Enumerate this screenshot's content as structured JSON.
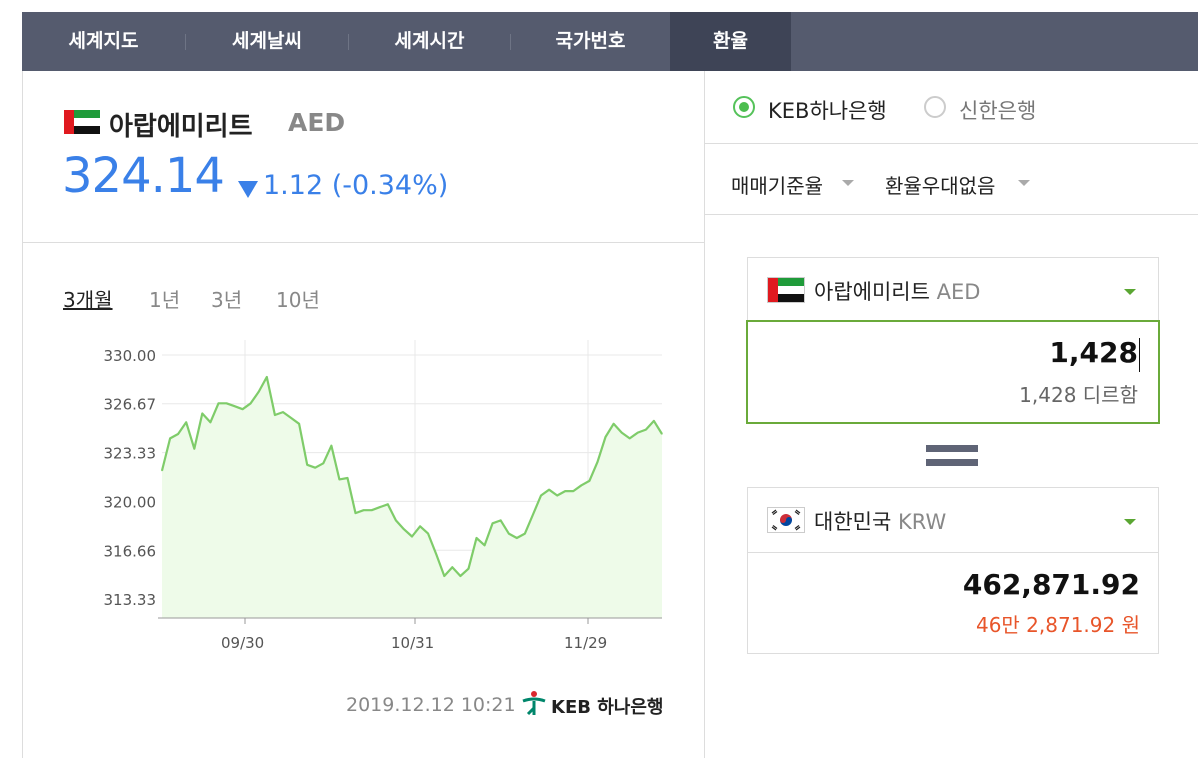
{
  "tabs": [
    {
      "label": "세계지도"
    },
    {
      "label": "세계날씨"
    },
    {
      "label": "세계시간"
    },
    {
      "label": "국가번호"
    },
    {
      "label": "환율"
    }
  ],
  "currency": {
    "country": "아랍에미리트",
    "code": "AED",
    "rate": "324.14",
    "change": "1.12 (-0.34%)",
    "direction": "down"
  },
  "periods": [
    "3개월",
    "1년",
    "3년",
    "10년"
  ],
  "chart_data": {
    "type": "area",
    "y_ticks": [
      "330.00",
      "326.67",
      "323.33",
      "320.00",
      "316.66",
      "313.33"
    ],
    "x_ticks": [
      "09/30",
      "10/31",
      "11/29"
    ],
    "ylim": [
      311.0,
      331.5
    ],
    "grid": true,
    "series": [
      {
        "color": "#7fcc6a",
        "values": [
          322.1,
          324.3,
          324.6,
          325.4,
          323.6,
          326.0,
          325.4,
          326.7,
          326.7,
          326.5,
          326.3,
          326.7,
          327.5,
          328.5,
          325.9,
          326.1,
          325.7,
          325.3,
          322.5,
          322.3,
          322.6,
          323.8,
          321.5,
          321.6,
          319.2,
          319.4,
          319.4,
          319.6,
          319.8,
          318.7,
          318.1,
          317.6,
          318.3,
          317.8,
          316.4,
          314.9,
          315.5,
          314.9,
          315.4,
          317.5,
          317.0,
          318.5,
          318.7,
          317.8,
          317.5,
          317.8,
          319.1,
          320.4,
          320.8,
          320.4,
          320.7,
          320.7,
          321.1,
          321.4,
          322.7,
          324.4,
          325.3,
          324.7,
          324.3,
          324.7,
          324.9,
          325.5,
          324.6
        ]
      }
    ]
  },
  "timestamp": "2019.12.12 10:21",
  "bank_logo_text": "KEB 하나은행",
  "banks": [
    {
      "label": "KEB하나은행",
      "checked": true
    },
    {
      "label": "신한은행",
      "checked": false
    }
  ],
  "dropdowns": [
    "매매기준율",
    "환율우대없음"
  ],
  "from": {
    "country": "아랍에미리트",
    "code": "AED",
    "amount": "1,428",
    "amount_text": "1,428 디르함"
  },
  "to": {
    "country": "대한민국",
    "code": "KRW",
    "amount": "462,871.92",
    "amount_text": "46만 2,871.92 원"
  }
}
